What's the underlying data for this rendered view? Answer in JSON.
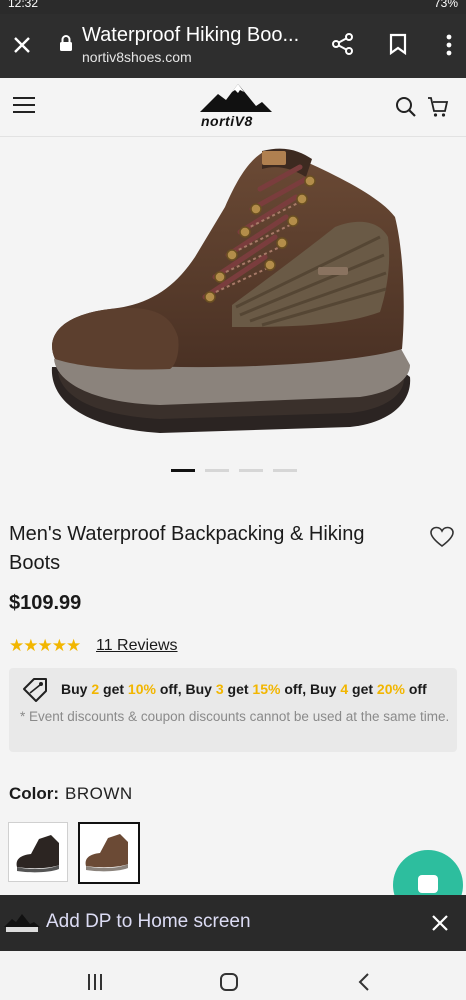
{
  "status_bar": {
    "time": "12:32",
    "battery": "73%"
  },
  "browser": {
    "page_title": "Waterproof Hiking Boo...",
    "url": "nortiv8shoes.com",
    "icons": [
      "close-icon",
      "lock-icon",
      "share-icon",
      "bookmark-icon",
      "more-vert-icon"
    ]
  },
  "site": {
    "logo_text": "nortiV8",
    "icons": [
      "menu-icon",
      "search-icon",
      "cart-icon"
    ]
  },
  "gallery": {
    "slide_count": 4,
    "active_slide": 1
  },
  "product": {
    "title": "Men's Waterproof Backpacking & Hiking Boots",
    "price": "$109.99",
    "rating": 5,
    "reviews_label": "11 Reviews"
  },
  "promo": {
    "w_buy1": "Buy",
    "n1": "2",
    "w_get1": "get",
    "p1": "10%",
    "w_off1": "off, Buy",
    "n2": "3",
    "w_get2": "get",
    "p2": "15%",
    "w_off2": "off, Buy",
    "n3": "4",
    "w_get3": "get",
    "p3": "20%",
    "w_off3": "off",
    "note": "* Event discounts & coupon discounts cannot be used at the same time."
  },
  "color": {
    "label": "Color:",
    "selected": "BROWN",
    "options": [
      "black",
      "brown"
    ]
  },
  "add_to_home": {
    "text": "Add DP to Home screen"
  },
  "colors": {
    "accent_yellow": "#f2b600",
    "fab_green": "#2dbe9e",
    "chrome_bg": "#2e2e2e"
  }
}
